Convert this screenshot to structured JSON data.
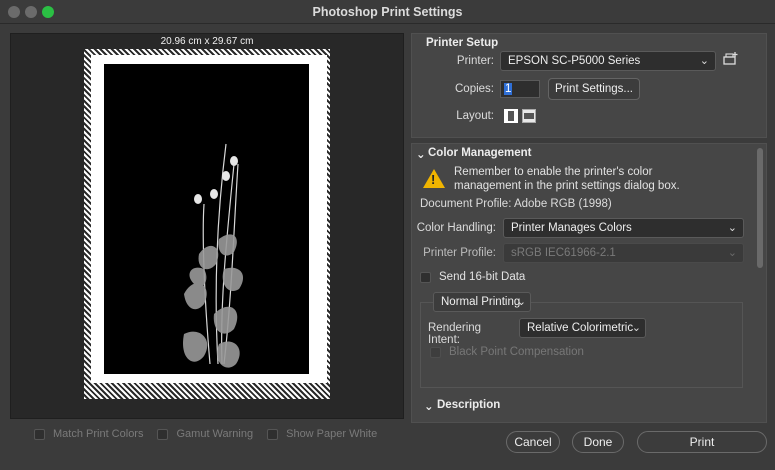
{
  "window": {
    "title": "Photoshop Print Settings"
  },
  "preview": {
    "dimensions": "20.96 cm x 29.67 cm",
    "checkboxes": [
      {
        "label": "Match Print Colors",
        "checked": false
      },
      {
        "label": "Gamut Warning",
        "checked": false
      },
      {
        "label": "Show Paper White",
        "checked": false
      }
    ]
  },
  "printer_setup": {
    "title": "Printer Setup",
    "printer_label": "Printer:",
    "printer_value": "EPSON SC-P5000 Series",
    "copies_label": "Copies:",
    "copies_value": "1",
    "print_settings_button": "Print Settings...",
    "layout_label": "Layout:"
  },
  "color_management": {
    "title": "Color Management",
    "warning": "Remember to enable the printer's color management in the print settings dialog box.",
    "document_profile": "Document Profile: Adobe RGB (1998)",
    "color_handling_label": "Color Handling:",
    "color_handling_value": "Printer Manages Colors",
    "printer_profile_label": "Printer Profile:",
    "printer_profile_value": "sRGB IEC61966-2.1",
    "send_16bit_label": "Send 16-bit Data",
    "normal_printing": "Normal Printing",
    "rendering_intent_label": "Rendering Intent:",
    "rendering_intent_value": "Relative Colorimetric",
    "black_point_label": "Black Point Compensation"
  },
  "description": {
    "title": "Description"
  },
  "buttons": {
    "cancel": "Cancel",
    "done": "Done",
    "print": "Print"
  },
  "colors": {
    "accent": "#2f6fd6",
    "warning": "#f0b400",
    "maximize": "#2bbf44"
  }
}
